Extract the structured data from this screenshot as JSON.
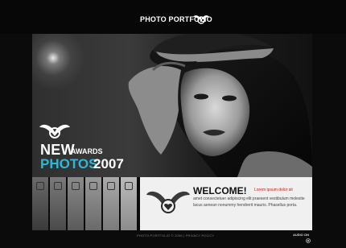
{
  "header": {
    "logo_text": "PHOTO PORTFOLIO"
  },
  "hero": {
    "headline_new": "NEW",
    "headline_awards": "AWARDS",
    "headline_photos": "PHOTOS",
    "headline_year": "2007",
    "accent_color": "#2fb8d6"
  },
  "nav": {
    "icons": [
      "home-icon",
      "camera-icon",
      "gear-icon",
      "calendar-icon",
      "building-icon",
      "mail-icon"
    ]
  },
  "welcome": {
    "title": "WELCOME!",
    "lead": "Lorem ipsum dolor sit",
    "body": "amet consectetuer adipiscing elit praesent vestibulum molestie lacus aenean nonummy hendrerit mauris. Phasellus porta.",
    "accent_color": "#c41b1b"
  },
  "footer": {
    "copyright": "PHOTO PORTFOLIO © 2006 | PRIVACY POLICY",
    "audio_label": "AUDIO ON"
  }
}
